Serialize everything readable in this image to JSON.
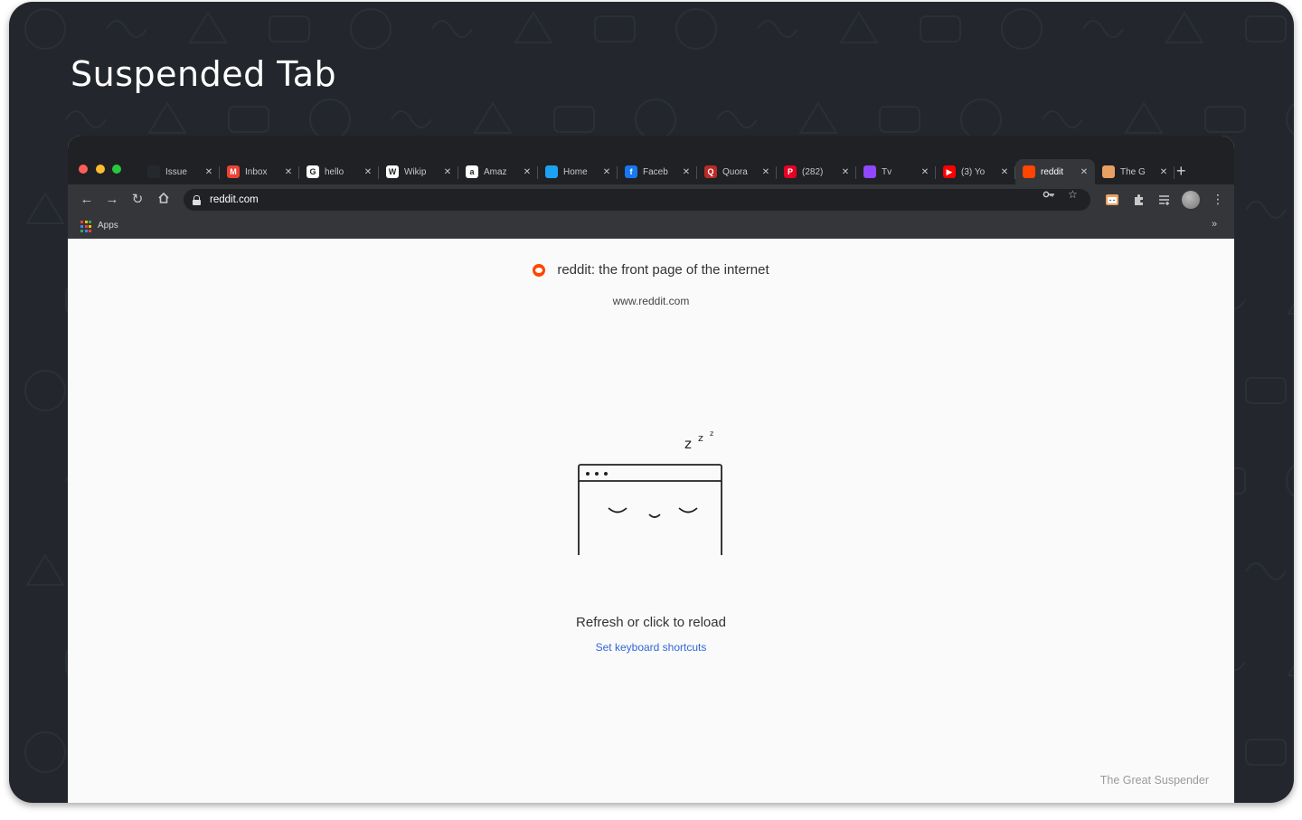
{
  "card": {
    "title": "Suspended Tab"
  },
  "browser": {
    "tabs": [
      {
        "label": "Issue",
        "icon": "github-icon",
        "color": "#24292e",
        "glyph": "",
        "active": false
      },
      {
        "label": "Inbox",
        "icon": "gmail-icon",
        "color": "#ea4335",
        "glyph": "M",
        "active": false
      },
      {
        "label": "hello",
        "icon": "google-icon",
        "color": "#ffffff",
        "glyph": "G",
        "active": false
      },
      {
        "label": "Wikip",
        "icon": "wikipedia-icon",
        "color": "#ffffff",
        "glyph": "W",
        "active": false
      },
      {
        "label": "Amaz",
        "icon": "amazon-icon",
        "color": "#ffffff",
        "glyph": "a",
        "active": false
      },
      {
        "label": "Home",
        "icon": "twitter-icon",
        "color": "#1da1f2",
        "glyph": "",
        "active": false
      },
      {
        "label": "Faceb",
        "icon": "facebook-icon",
        "color": "#1877f2",
        "glyph": "f",
        "active": false
      },
      {
        "label": "Quora",
        "icon": "quora-icon",
        "color": "#b92b27",
        "glyph": "Q",
        "active": false
      },
      {
        "label": "(282)",
        "icon": "pinterest-icon",
        "color": "#e60023",
        "glyph": "P",
        "active": false
      },
      {
        "label": "Tv",
        "icon": "twitch-icon",
        "color": "#9146ff",
        "glyph": "",
        "active": false
      },
      {
        "label": "(3) Yo",
        "icon": "youtube-icon",
        "color": "#ff0000",
        "glyph": "▶",
        "active": false
      },
      {
        "label": "reddit",
        "icon": "reddit-icon",
        "color": "#ff4500",
        "glyph": "",
        "active": true
      },
      {
        "label": "The G",
        "icon": "suspender-icon",
        "color": "#e8a163",
        "glyph": "",
        "active": false
      }
    ],
    "tab_close_glyph": "✕",
    "new_tab_glyph": "+",
    "url": "reddit.com",
    "bookmarks": {
      "apps_label": "Apps",
      "more_glyph": "»"
    }
  },
  "page": {
    "site_title": "reddit: the front page of the internet",
    "site_url": "www.reddit.com",
    "zzz": "z",
    "reload_text": "Refresh or click to reload",
    "shortcuts_link": "Set keyboard shortcuts",
    "branding": "The Great Suspender"
  }
}
